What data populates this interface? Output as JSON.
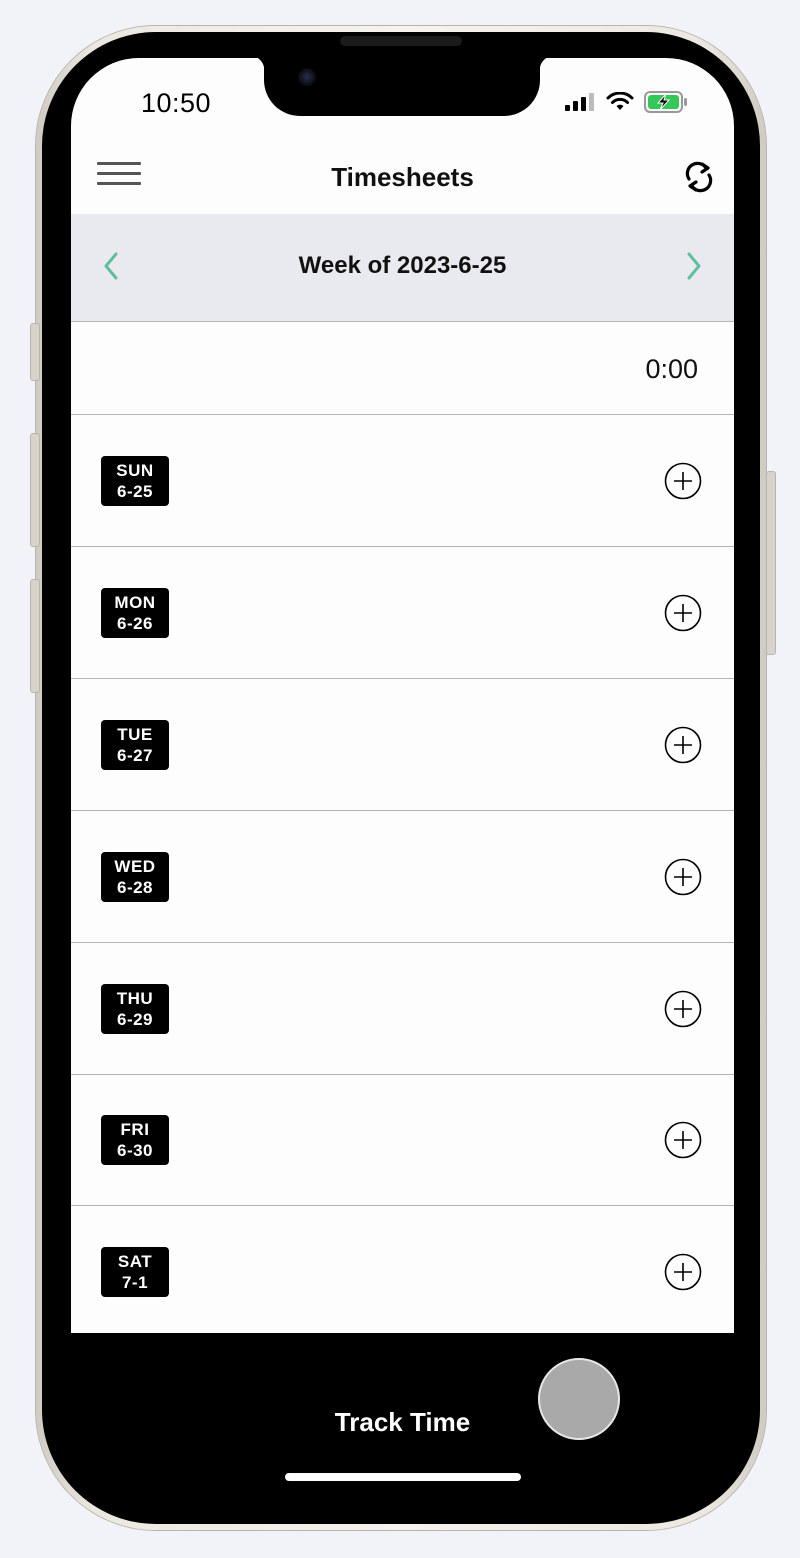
{
  "status_bar": {
    "time": "10:50",
    "battery_color": "#34c759"
  },
  "header": {
    "title": "Timesheets",
    "menu_icon": "hamburger-menu-icon",
    "refresh_icon": "refresh-icon"
  },
  "week_nav": {
    "title": "Week of 2023-6-25",
    "prev_icon": "chevron-left-icon",
    "next_icon": "chevron-right-icon",
    "accent_color": "#5fbf9a"
  },
  "summary": {
    "total": "0:00"
  },
  "days": [
    {
      "day": "SUN",
      "date": "6-25"
    },
    {
      "day": "MON",
      "date": "6-26"
    },
    {
      "day": "TUE",
      "date": "6-27"
    },
    {
      "day": "WED",
      "date": "6-28"
    },
    {
      "day": "THU",
      "date": "6-29"
    },
    {
      "day": "FRI",
      "date": "6-30"
    },
    {
      "day": "SAT",
      "date": "7-1"
    }
  ],
  "footer": {
    "track_label": "Track Time"
  }
}
